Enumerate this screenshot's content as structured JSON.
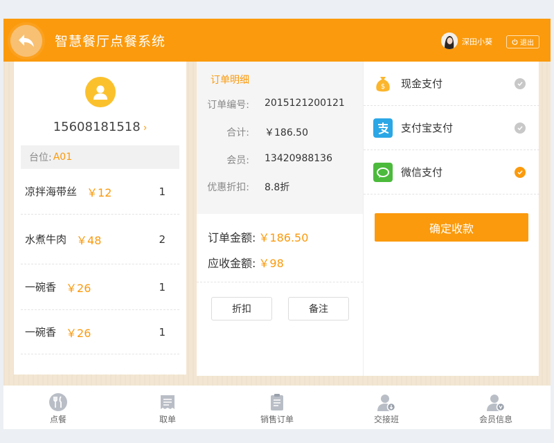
{
  "header": {
    "title": "智慧餐厅点餐系统",
    "user_name": "深田小葵",
    "logout_label": "退出"
  },
  "member": {
    "phone": "15608181518",
    "table_label": "台位:",
    "table_value": "A01"
  },
  "dishes": [
    {
      "name": "凉拌海带丝",
      "price": "￥12",
      "qty": "1"
    },
    {
      "name": "水煮牛肉",
      "price": "￥48",
      "qty": "2"
    },
    {
      "name": "一碗香",
      "price": "￥26",
      "qty": "1"
    },
    {
      "name": "一碗香",
      "price": "￥26",
      "qty": "1"
    }
  ],
  "order": {
    "title": "订单明细",
    "details": [
      {
        "key": "订单编号:",
        "value": "2015121200121"
      },
      {
        "key": "合计:",
        "value": "￥186.50"
      },
      {
        "key": "会员:",
        "value": "13420988136"
      },
      {
        "key": "优惠折扣:",
        "value": "8.8折"
      }
    ],
    "order_amount_label": "订单金额:",
    "order_amount_value": "￥186.50",
    "receivable_label": "应收金额:",
    "receivable_value": "￥98",
    "discount_button": "折扣",
    "note_button": "备注"
  },
  "payment": {
    "methods": [
      {
        "label": "现金支付",
        "selected": false,
        "icon": "money-bag-icon",
        "color": "#fbb62d"
      },
      {
        "label": "支付宝支付",
        "selected": false,
        "icon": "alipay-icon",
        "color": "#2ba7e6"
      },
      {
        "label": "微信支付",
        "selected": true,
        "icon": "wechat-icon",
        "color": "#4cba3c"
      }
    ],
    "confirm_label": "确定收款"
  },
  "nav": {
    "items": [
      {
        "label": "点餐",
        "icon": "utensils-icon"
      },
      {
        "label": "取单",
        "icon": "receipt-icon"
      },
      {
        "label": "销售订单",
        "icon": "clipboard-icon"
      },
      {
        "label": "交接班",
        "icon": "user-shift-icon"
      },
      {
        "label": "会员信息",
        "icon": "member-icon"
      }
    ]
  },
  "colors": {
    "accent": "#fb9a0c",
    "check_selected": "#fb9a0c",
    "check_unselected": "#c8c8c8"
  }
}
